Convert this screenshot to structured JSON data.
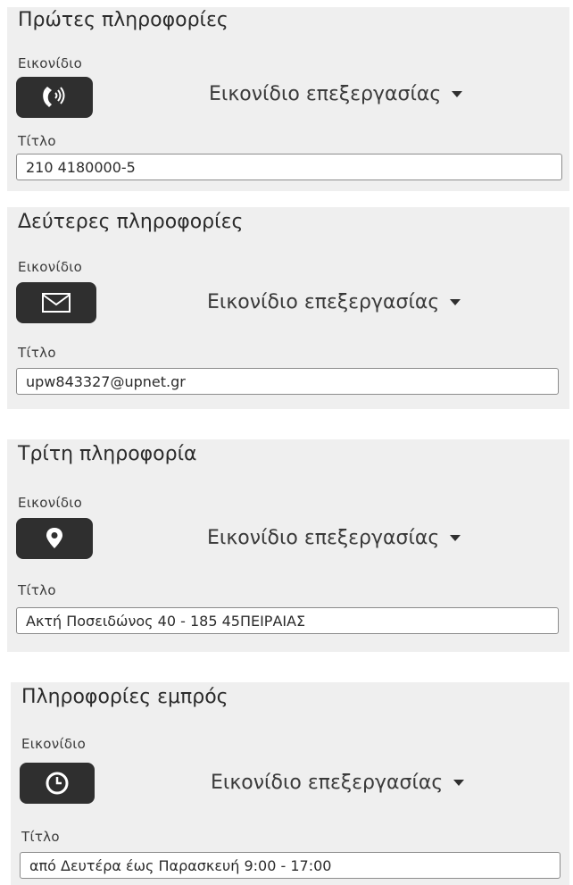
{
  "common": {
    "icon_label": "Εικονίδιο",
    "edit_icon_label": "Εικονίδιο επεξεργασίας",
    "title_label": "Τίτλο"
  },
  "sections": [
    {
      "title": "Πρώτες πληροφορίες",
      "icon": "phone-ringing-icon",
      "value": "210 4180000-5"
    },
    {
      "title": "Δεύτερες πληροφορίες",
      "icon": "envelope-icon",
      "value": "upw843327@upnet.gr"
    },
    {
      "title": "Τρίτη πληροφορία",
      "icon": "map-marker-icon",
      "value": "Ακτή Ποσειδώνος 40 - 185 45ΠΕΙΡΑΙΑΣ"
    },
    {
      "title": "Πληροφορίες εμπρός",
      "icon": "clock-icon",
      "value": "από Δευτέρα έως Παρασκευή 9:00 - 17:00"
    }
  ],
  "colors": {
    "panel_bg": "#efefef",
    "icon_button_bg": "#2f2f2f",
    "icon_fg": "#ffffff"
  }
}
